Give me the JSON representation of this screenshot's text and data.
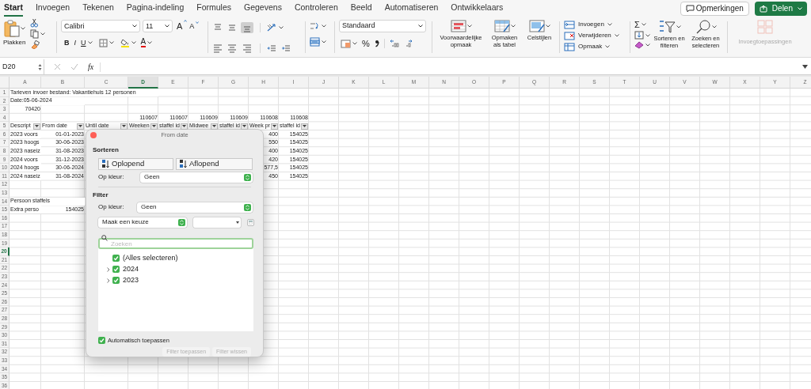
{
  "tabs": [
    {
      "label": "Start",
      "selected": true
    },
    {
      "label": "Invoegen",
      "selected": false
    },
    {
      "label": "Tekenen",
      "selected": false
    },
    {
      "label": "Pagina-indeling",
      "selected": false
    },
    {
      "label": "Formules",
      "selected": false
    },
    {
      "label": "Gegevens",
      "selected": false
    },
    {
      "label": "Controleren",
      "selected": false
    },
    {
      "label": "Beeld",
      "selected": false
    },
    {
      "label": "Automatiseren",
      "selected": false
    },
    {
      "label": "Ontwikkelaars",
      "selected": false
    }
  ],
  "header_buttons": {
    "comments": "Opmerkingen",
    "share": "Delen"
  },
  "ribbon": {
    "clipboard": {
      "paste": "Plakken"
    },
    "font": {
      "name": "Calibri",
      "size": "11",
      "grow": "A",
      "shrink": "A",
      "bold": "B",
      "italic": "I",
      "underline": "U",
      "font_color": "A"
    },
    "vertical_alignment": [
      {
        "selected": false
      },
      {
        "selected": false
      },
      {
        "selected": true
      }
    ],
    "number": {
      "format": "Standaard",
      "percent": "%"
    },
    "styles": [
      "Voorwaardelijke opmaak",
      "Opmaken als tabel",
      "Celstijlen"
    ],
    "cells": [
      "Invoegen",
      "Verwijderen",
      "Opmaak"
    ],
    "editing": {
      "autosum": "Σ",
      "sort_filter": "Sorteren en filteren",
      "find": "Zoeken en selecteren"
    },
    "addins": {
      "label": "Invoegtoepassingen",
      "disabled": true
    }
  },
  "formula_bar": {
    "cell": "D20",
    "fx": "fx"
  },
  "sheet": {
    "columns": [
      {
        "label": "A",
        "selected": false
      },
      {
        "label": "B",
        "selected": false
      },
      {
        "label": "C",
        "selected": false
      },
      {
        "label": "D",
        "selected": true
      },
      {
        "label": "E",
        "selected": false
      },
      {
        "label": "F",
        "selected": false
      },
      {
        "label": "G",
        "selected": false
      },
      {
        "label": "H",
        "selected": false
      },
      {
        "label": "I",
        "selected": false
      },
      {
        "label": "J",
        "selected": false
      },
      {
        "label": "K",
        "selected": false
      },
      {
        "label": "L",
        "selected": false
      },
      {
        "label": "M",
        "selected": false
      },
      {
        "label": "N",
        "selected": false
      },
      {
        "label": "O",
        "selected": false
      },
      {
        "label": "P",
        "selected": false
      },
      {
        "label": "Q",
        "selected": false
      },
      {
        "label": "R",
        "selected": false
      },
      {
        "label": "S",
        "selected": false
      },
      {
        "label": "T",
        "selected": false
      },
      {
        "label": "U",
        "selected": false
      },
      {
        "label": "V",
        "selected": false
      },
      {
        "label": "W",
        "selected": false
      },
      {
        "label": "X",
        "selected": false
      },
      {
        "label": "Y",
        "selected": false
      },
      {
        "label": "Z",
        "selected": false
      }
    ],
    "rows": [
      {
        "label": "1",
        "selected": false,
        "cells": [
          {
            "text": "Tarieven invoer bestand: Vakantiehuis 12 personen",
            "kind": "text"
          }
        ]
      },
      {
        "label": "2",
        "selected": false,
        "cells": [
          {
            "text": "Date:05-06-2024",
            "kind": "text"
          }
        ]
      },
      {
        "label": "3",
        "selected": false,
        "cells": [
          {
            "text": "70420",
            "kind": "number"
          }
        ]
      },
      {
        "label": "4",
        "selected": false,
        "cells": [
          null,
          null,
          null,
          {
            "text": "110607",
            "kind": "number"
          },
          {
            "text": "110607",
            "kind": "number"
          },
          {
            "text": "110609",
            "kind": "number"
          },
          {
            "text": "110609",
            "kind": "number"
          },
          {
            "text": "110608",
            "kind": "number"
          },
          {
            "text": "110608",
            "kind": "number"
          }
        ]
      },
      {
        "label": "5",
        "selected": false,
        "cells": [
          {
            "text": "Descript",
            "kind": "header"
          },
          {
            "text": "From date",
            "kind": "header"
          },
          {
            "text": "Until date",
            "kind": "header"
          },
          {
            "text": "Weeken",
            "kind": "header"
          },
          {
            "text": "staffel id",
            "kind": "header"
          },
          {
            "text": "Midwee",
            "kind": "header"
          },
          {
            "text": "staffel id",
            "kind": "header"
          },
          {
            "text": "Week pr",
            "kind": "header"
          },
          {
            "text": "staffel id",
            "kind": "header"
          }
        ]
      },
      {
        "label": "6",
        "selected": false,
        "cells": [
          {
            "text": "2023 voors",
            "kind": "text"
          },
          {
            "text": "01-01-2023",
            "kind": "number"
          },
          null,
          null,
          null,
          null,
          null,
          {
            "text": "400",
            "kind": "number"
          },
          {
            "text": "154025",
            "kind": "number"
          }
        ]
      },
      {
        "label": "7",
        "selected": false,
        "cells": [
          {
            "text": "2023 hoogs",
            "kind": "text"
          },
          {
            "text": "30-06-2023",
            "kind": "number"
          },
          null,
          null,
          null,
          null,
          null,
          {
            "text": "550",
            "kind": "number"
          },
          {
            "text": "154025",
            "kind": "number"
          }
        ]
      },
      {
        "label": "8",
        "selected": false,
        "cells": [
          {
            "text": "2023 naseiz",
            "kind": "text"
          },
          {
            "text": "31-08-2023",
            "kind": "number"
          },
          null,
          null,
          null,
          null,
          null,
          {
            "text": "400",
            "kind": "number"
          },
          {
            "text": "154025",
            "kind": "number"
          }
        ]
      },
      {
        "label": "9",
        "selected": false,
        "cells": [
          {
            "text": "2024 voors",
            "kind": "text"
          },
          {
            "text": "31-12-2023",
            "kind": "number"
          },
          null,
          null,
          null,
          null,
          null,
          {
            "text": "420",
            "kind": "number"
          },
          {
            "text": "154025",
            "kind": "number"
          }
        ]
      },
      {
        "label": "10",
        "selected": false,
        "cells": [
          {
            "text": "2024 hoogs",
            "kind": "text"
          },
          {
            "text": "30-06-2024",
            "kind": "number"
          },
          null,
          null,
          null,
          null,
          null,
          {
            "text": "577,5",
            "kind": "number"
          },
          {
            "text": "154025",
            "kind": "number"
          }
        ]
      },
      {
        "label": "11",
        "selected": false,
        "cells": [
          {
            "text": "2024 naseiz",
            "kind": "text"
          },
          {
            "text": "31-08-2024",
            "kind": "number"
          },
          null,
          null,
          null,
          null,
          null,
          {
            "text": "450",
            "kind": "number"
          },
          {
            "text": "154025",
            "kind": "number"
          }
        ]
      },
      {
        "label": "12",
        "selected": false
      },
      {
        "label": "13",
        "selected": false
      },
      {
        "label": "14",
        "selected": false,
        "cells": [
          {
            "text": "Persoon staffels",
            "kind": "text"
          }
        ]
      },
      {
        "label": "15",
        "selected": false,
        "cells": [
          {
            "text": "Extra perso",
            "kind": "text"
          },
          {
            "text": "154025",
            "kind": "number"
          }
        ]
      },
      {
        "label": "16",
        "selected": false
      },
      {
        "label": "17",
        "selected": false
      },
      {
        "label": "18",
        "selected": false
      },
      {
        "label": "19",
        "selected": false
      },
      {
        "label": "20",
        "selected": true
      },
      {
        "label": "21",
        "selected": false
      },
      {
        "label": "22",
        "selected": false
      },
      {
        "label": "23",
        "selected": false
      },
      {
        "label": "24",
        "selected": false
      },
      {
        "label": "25",
        "selected": false
      },
      {
        "label": "26",
        "selected": false
      },
      {
        "label": "27",
        "selected": false
      },
      {
        "label": "28",
        "selected": false
      },
      {
        "label": "29",
        "selected": false
      },
      {
        "label": "30",
        "selected": false
      },
      {
        "label": "31",
        "selected": false
      },
      {
        "label": "32",
        "selected": false
      },
      {
        "label": "33",
        "selected": false
      },
      {
        "label": "34",
        "selected": false
      },
      {
        "label": "35",
        "selected": false
      },
      {
        "label": "36",
        "selected": false
      }
    ]
  },
  "filter_popup": {
    "title": "From date",
    "sort": {
      "heading": "Sorteren",
      "ascending": "Oplopend",
      "descending": "Aflopend",
      "color_label": "Op kleur:",
      "color_value": "Geen"
    },
    "filter": {
      "heading": "Filter",
      "color_label": "Op kleur:",
      "color_value": "Geen",
      "condition": "Maak een keuze",
      "search_placeholder": "Zoeken",
      "items": [
        {
          "label": "(Alles selecteren)",
          "checked": true,
          "kind": "all"
        },
        {
          "label": "2024",
          "checked": true,
          "kind": "group"
        },
        {
          "label": "2023",
          "checked": true,
          "kind": "group"
        }
      ]
    },
    "auto_apply": {
      "label": "Automatisch toepassen",
      "checked": true
    },
    "buttons": [
      {
        "label": "Filter toepassen",
        "disabled": true
      },
      {
        "label": "Filter wissen",
        "disabled": true
      }
    ]
  }
}
